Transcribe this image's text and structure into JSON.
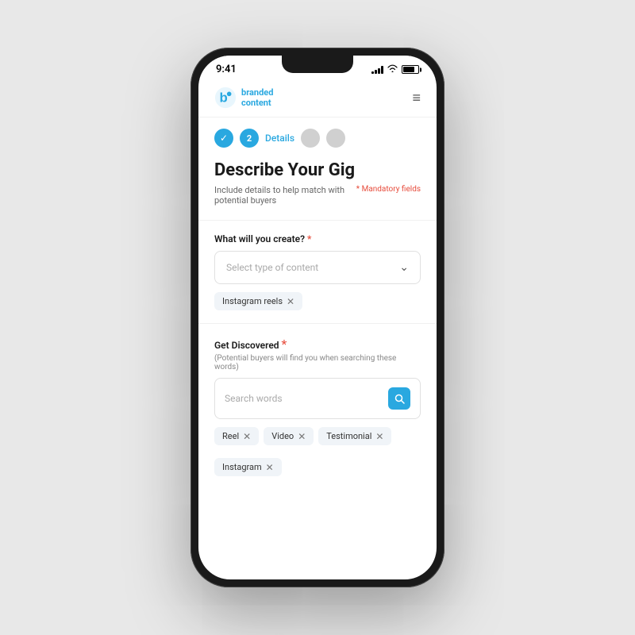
{
  "status_bar": {
    "time": "9:41"
  },
  "header": {
    "logo_text_line1": "branded",
    "logo_text_line2": "content",
    "menu_icon": "≡"
  },
  "steps": {
    "check_label": "✓",
    "active_number": "2",
    "active_label": "Details"
  },
  "page": {
    "title": "Describe Your Gig",
    "subtitle": "Include details to help match with potential buyers",
    "mandatory_label": "* Mandatory fields"
  },
  "form": {
    "content_type_label": "What will you create?",
    "content_type_placeholder": "Select type of content",
    "selected_tags": [
      {
        "label": "Instagram reels"
      }
    ],
    "get_discovered_label": "Get Discovered",
    "get_discovered_note": "(Potential buyers will find you when searching these words)",
    "search_placeholder": "Search words",
    "search_tags": [
      {
        "label": "Reel"
      },
      {
        "label": "Video"
      },
      {
        "label": "Testimonial"
      },
      {
        "label": "Instagram"
      }
    ]
  }
}
